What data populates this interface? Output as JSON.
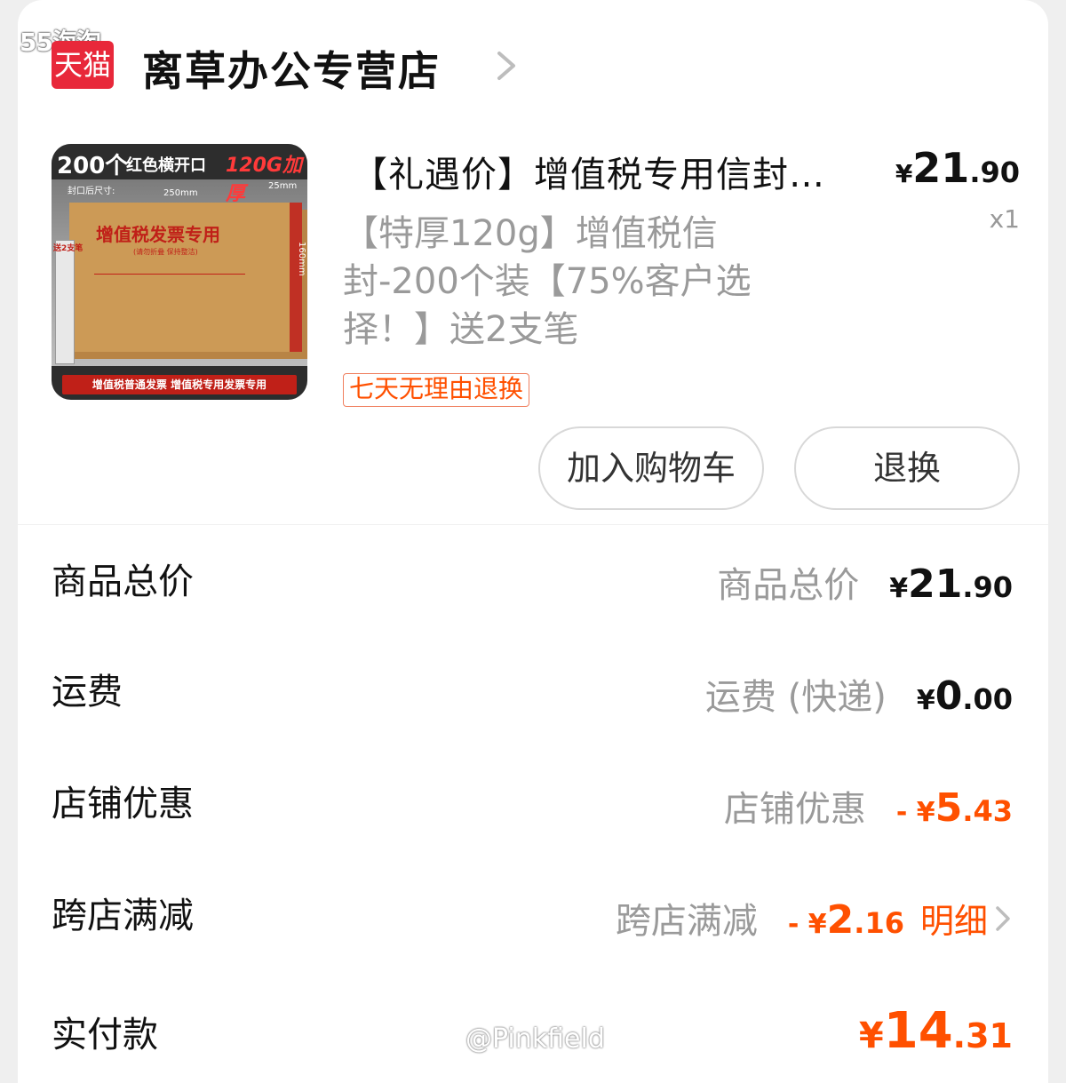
{
  "watermark_top": "55海淘",
  "watermark_bottom": "@Pinkfield",
  "store": {
    "logo_text": "天猫",
    "name": "离草办公专营店",
    "chevron_icon": "chevron-right-icon"
  },
  "product": {
    "image": {
      "top_count": "200个",
      "top_label": "红色横开口",
      "top_weight": "120G加厚",
      "dim_label": "封口后尺寸:",
      "width_label": "250mm",
      "flap_label": "25mm",
      "height_label": "160mm",
      "envelope_title": "增值税发票专用",
      "envelope_sub": "(请勿折叠 保持整洁)",
      "pens_label": "送2支笔",
      "bottom_text": "增值税普通发票 增值税专用发票专用"
    },
    "title": "【礼遇价】增值税专用信封…",
    "price_yen": "¥",
    "price_int": "21",
    "price_dec": ".90",
    "quantity": "x1",
    "description": "【特厚120g】增值税信封-200个装【75%客户选择！】送2支笔",
    "service_tag": "七天无理由退换",
    "add_to_cart_label": "加入购物车",
    "return_label": "退换"
  },
  "summary": {
    "goods_total": {
      "label": "商品总价",
      "sub": "商品总价",
      "yen": "¥",
      "int": "21",
      "dec": ".90"
    },
    "shipping": {
      "label": "运费",
      "sub": "运费 (快递)",
      "yen": "¥",
      "int": "0",
      "dec": ".00"
    },
    "store_discount": {
      "label": "店铺优惠",
      "sub": "店铺优惠",
      "yen": "- ¥",
      "int": "5",
      "dec": ".43"
    },
    "cross_store": {
      "label": "跨店满减",
      "sub": "跨店满减",
      "yen": "- ¥",
      "int": "2",
      "dec": ".16",
      "detail": "明细"
    },
    "actual_paid": {
      "label": "实付款",
      "yen": "¥",
      "int": "14",
      "dec": ".31"
    }
  },
  "colors": {
    "accent": "#ff5000",
    "tmall_red": "#e8283a",
    "muted_text": "#9a9a9a"
  }
}
